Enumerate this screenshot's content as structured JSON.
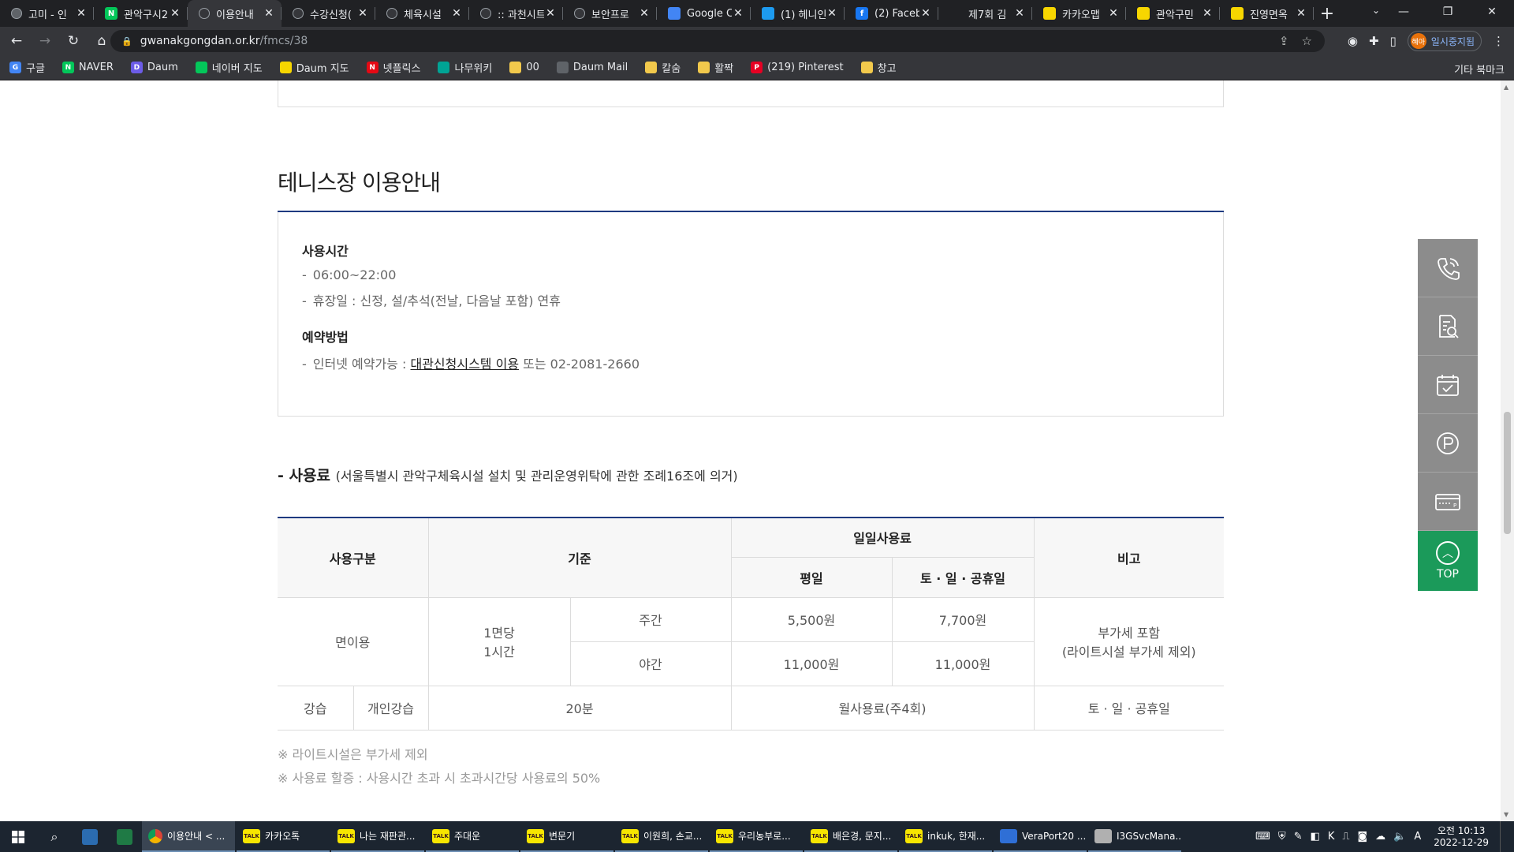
{
  "browser": {
    "tabs": [
      {
        "title": "고미 - 인",
        "icon_color": "#5f6368",
        "icon": "globe-icon"
      },
      {
        "title": "관악구시2",
        "icon_color": "#03c75a",
        "icon": "naver-icon",
        "letter": "N"
      },
      {
        "title": "이용안내",
        "icon_color": "#35363a",
        "icon": "site-icon",
        "active": true
      },
      {
        "title": "수강신청(",
        "icon_color": "#35363a",
        "icon": "site-icon"
      },
      {
        "title": "체육시설",
        "icon_color": "#35363a",
        "icon": "site-icon"
      },
      {
        "title": ":: 과천시트",
        "icon_color": "#35363a",
        "icon": "site-icon"
      },
      {
        "title": "보안프로",
        "icon_color": "#35363a",
        "icon": "site-icon"
      },
      {
        "title": "Google C",
        "icon_color": "#4285f4",
        "icon": "google-calendar-icon"
      },
      {
        "title": "(1) 헤니인",
        "icon_color": "#1d9bf0",
        "icon": "twitter-icon"
      },
      {
        "title": "(2) Faceb",
        "icon_color": "#1877f2",
        "icon": "facebook-icon",
        "letter": "f"
      },
      {
        "title": "제7회 김",
        "icon_color": "#202124",
        "icon": "blank-icon"
      },
      {
        "title": "카카오맵",
        "icon_color": "#f7d600",
        "icon": "kakaomap-icon"
      },
      {
        "title": "관악구민",
        "icon_color": "#f7d600",
        "icon": "kakaomap-icon"
      },
      {
        "title": "진영면옥",
        "icon_color": "#f7d600",
        "icon": "kakaomap-icon"
      }
    ],
    "url_host": "gwanakgongdan.or.kr",
    "url_path": "/fmcs/38",
    "profile_label": "일시중지됨",
    "profile_avatar": "혜아",
    "bookmarks": [
      {
        "label": "구글",
        "color": "#4285f4",
        "letter": "G",
        "icon": "google-icon"
      },
      {
        "label": "NAVER",
        "color": "#03c75a",
        "letter": "N",
        "icon": "naver-icon"
      },
      {
        "label": "Daum",
        "color": "#6c5ce7",
        "letter": "D",
        "icon": "daum-icon"
      },
      {
        "label": "네이버 지도",
        "color": "#03c75a",
        "letter": "",
        "icon": "naver-map-icon"
      },
      {
        "label": "Daum 지도",
        "color": "#f7d600",
        "letter": "",
        "icon": "daum-map-icon"
      },
      {
        "label": "넷플릭스",
        "color": "#e50914",
        "letter": "N",
        "icon": "netflix-icon"
      },
      {
        "label": "나무위키",
        "color": "#00a495",
        "letter": "",
        "icon": "namuwiki-icon"
      },
      {
        "label": "00",
        "color": "#f2c94c",
        "letter": "",
        "icon": "folder-icon"
      },
      {
        "label": "Daum Mail",
        "color": "#5f6368",
        "letter": "",
        "icon": "mail-icon"
      },
      {
        "label": "칼숨",
        "color": "#f2c94c",
        "letter": "",
        "icon": "folder-icon"
      },
      {
        "label": "활짝",
        "color": "#f2c94c",
        "letter": "",
        "icon": "folder-icon"
      },
      {
        "label": "(219) Pinterest",
        "color": "#e60023",
        "letter": "P",
        "icon": "pinterest-icon"
      },
      {
        "label": "창고",
        "color": "#f2c94c",
        "letter": "",
        "icon": "folder-icon"
      }
    ],
    "other_bookmarks": "기타 북마크"
  },
  "page": {
    "section_title": "테니스장 이용안내",
    "usage_time_heading": "사용시간",
    "usage_time_items": [
      "06:00~22:00",
      "휴장일 : 신정, 설/추석(전날, 다음날 포함) 연휴"
    ],
    "reservation_heading": "예약방법",
    "reservation_prefix": "인터넷 예약가능 : ",
    "reservation_link": "대관신청시스템 이용",
    "reservation_suffix": " 또는 02-2081-2660",
    "fee_title": "- 사용료",
    "fee_subtitle": "(서울특별시 관악구체육시설 설치 및 관리운영위탁에 관한 조례16조에 의거)",
    "table": {
      "h_type": "사용구분",
      "h_basis": "기준",
      "h_daily": "일일사용료",
      "h_note": "비고",
      "h_weekday": "평일",
      "h_weekend": "토 · 일 · 공휴일",
      "r1_type": "면이용",
      "r1_basis1": "1면당",
      "r1_basis2": "1시간",
      "r1_day": "주간",
      "r1_day_weekday": "5,500원",
      "r1_day_weekend": "7,700원",
      "r1_night": "야간",
      "r1_night_weekday": "11,000원",
      "r1_night_weekend": "11,000원",
      "r1_note1": "부가세 포함",
      "r1_note2": "(라이트시설 부가세 제외)",
      "r2_type": "강습",
      "r2_sub": "개인강습",
      "r2_basis": "20분",
      "r2_fee": "월사용료(주4회)",
      "r2_note": "토 · 일 · 공휴일"
    },
    "notes": [
      "※ 라이트시설은 부가세 제외",
      "※ 사용료 할증 : 사용시간 초과 시 초과시간당 사용료의 50%"
    ],
    "quick_top_label": "TOP"
  },
  "taskbar": {
    "apps": [
      {
        "label": "이용안내 < ...",
        "color": "#ffffff",
        "icon": "chrome-icon",
        "active": true
      },
      {
        "label": "카카오톡",
        "color": "#f7e600",
        "icon": "kakaotalk-icon"
      },
      {
        "label": "나는 재판관...",
        "color": "#f7e600",
        "icon": "kakaotalk-icon"
      },
      {
        "label": "주대운",
        "color": "#f7e600",
        "icon": "kakaotalk-icon"
      },
      {
        "label": "변문기",
        "color": "#f7e600",
        "icon": "kakaotalk-icon"
      },
      {
        "label": "이원희, 손교...",
        "color": "#f7e600",
        "icon": "kakaotalk-icon"
      },
      {
        "label": "우리농부로...",
        "color": "#f7e600",
        "icon": "kakaotalk-icon"
      },
      {
        "label": "배은경, 문지...",
        "color": "#f7e600",
        "icon": "kakaotalk-icon"
      },
      {
        "label": "inkuk, 한재...",
        "color": "#f7e600",
        "icon": "kakaotalk-icon"
      },
      {
        "label": "VeraPort20 ...",
        "color": "#2f6fd6",
        "icon": "veraport-icon"
      },
      {
        "label": "I3GSvcMana...",
        "color": "#b0b0b0",
        "icon": "service-icon"
      }
    ],
    "time": "오전 10:13",
    "date": "2022-12-29"
  }
}
